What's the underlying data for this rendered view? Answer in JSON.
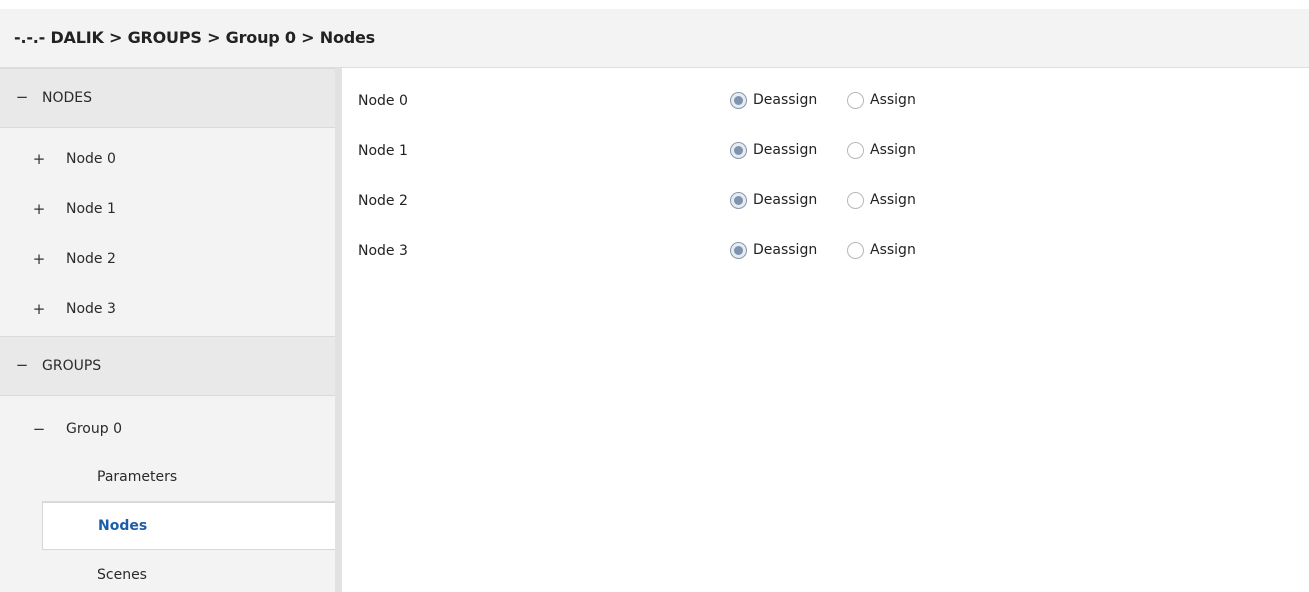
{
  "header": {
    "breadcrumb": "-.-.- DALIK > GROUPS > Group 0 > Nodes"
  },
  "sidebar": {
    "sections": [
      {
        "label": "NODES",
        "expander": "−",
        "items": [
          {
            "label": "Node 0",
            "expander": "+"
          },
          {
            "label": "Node 1",
            "expander": "+"
          },
          {
            "label": "Node 2",
            "expander": "+"
          },
          {
            "label": "Node 3",
            "expander": "+"
          }
        ]
      },
      {
        "label": "GROUPS",
        "expander": "−",
        "items": [
          {
            "label": "Group 0",
            "expander": "−",
            "children": [
              {
                "label": "Parameters",
                "selected": false
              },
              {
                "label": "Nodes",
                "selected": true
              },
              {
                "label": "Scenes",
                "selected": false
              }
            ]
          }
        ]
      }
    ]
  },
  "main": {
    "option_labels": {
      "deassign": "Deassign",
      "assign": "Assign"
    },
    "rows": [
      {
        "label": "Node 0",
        "value": "Deassign"
      },
      {
        "label": "Node 1",
        "value": "Deassign"
      },
      {
        "label": "Node 2",
        "value": "Deassign"
      },
      {
        "label": "Node 3",
        "value": "Deassign"
      }
    ]
  },
  "colors": {
    "selected_text": "#1a5ea8",
    "sidebar_bg": "#f3f3f3",
    "section_bg": "#e9e9e9"
  }
}
